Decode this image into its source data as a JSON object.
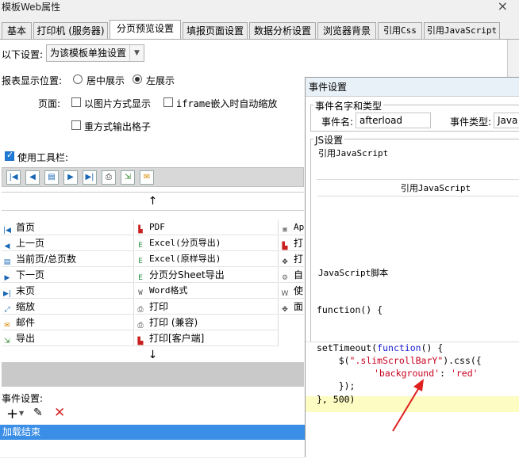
{
  "window": {
    "title": "模板Web属性",
    "close": "×"
  },
  "tabs": [
    {
      "label": "基本"
    },
    {
      "label": "打印机 (服务器)"
    },
    {
      "label": "分页预览设置"
    },
    {
      "label": "填报页面设置"
    },
    {
      "label": "数据分析设置"
    },
    {
      "label": "浏览器背景"
    },
    {
      "label": "引用Css"
    },
    {
      "label": "引用JavaScript"
    }
  ],
  "settings": {
    "mode_label": "以下设置:",
    "mode_value": "为该模板单独设置",
    "position_label": "报表显示位置:",
    "pos_center": "居中展示",
    "pos_left": "左展示",
    "page_label": "页面:",
    "opt_image": "以图片方式显示",
    "opt_iframe": "iframe嵌入时自动缩放",
    "opt_reprint": "重方式输出格子",
    "use_toolbar": "使用工具栏:"
  },
  "toolbar_grid": {
    "col1": [
      "首页",
      "上一页",
      "当前页/总页数",
      "下一页",
      "末页",
      "缩放",
      "邮件",
      "导出"
    ],
    "col2": [
      "PDF",
      "Excel(分页导出)",
      "Excel(原样导出)",
      "分页分Sheet导出",
      "Word格式",
      "打印",
      "打印 (兼容)",
      "打印[客户端]"
    ],
    "col3": [
      "Ap",
      "打",
      "打",
      "自",
      "使",
      "面"
    ],
    "up_arrow": "↑",
    "down_arrow": "↓"
  },
  "events": {
    "label": "事件设置:",
    "add": "+",
    "edit": "✎",
    "delete": "✕",
    "selected_item": "加载结束"
  },
  "dialog": {
    "title": "事件设置",
    "name_group": "事件名字和类型",
    "name_label": "事件名:",
    "name_value": "afterload",
    "type_label": "事件类型:",
    "type_value": "Java",
    "js_group": "JS设置",
    "ref_js_label": "引用JavaScript",
    "ref_js_header": "引用JavaScript",
    "script_label": "JavaScript脚本",
    "function_head": "function() {",
    "code": {
      "l1_a": "setTimeout(",
      "l1_kw": "function",
      "l1_b": "() {",
      "l2_a": "    $(",
      "l2_str": "\".slimScrollBarY\"",
      "l2_b": ").css({",
      "l3_str1": "'background'",
      "l3_colon": ": ",
      "l3_str2": "'red'",
      "l4": "    });",
      "l5": "}, 500)"
    }
  },
  "colors": {
    "accent": "#3a8ee6",
    "highlight": "#fdfcc3",
    "annotation": "#e02020"
  }
}
